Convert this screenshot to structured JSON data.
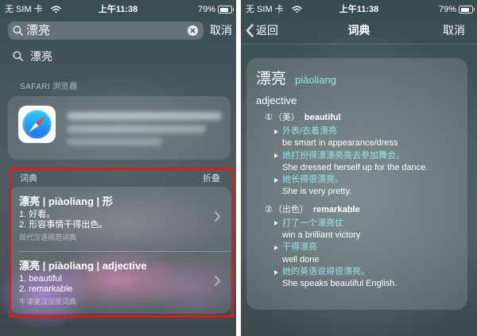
{
  "colors": {
    "accent": "#9be2e8",
    "annotation": "#e0191b"
  },
  "icons": [
    "wifi-icon",
    "battery-icon",
    "search-icon",
    "clear-icon",
    "safari-icon",
    "chevron-right-icon",
    "chevron-left-icon",
    "bullet-icon"
  ],
  "left": {
    "status_bar": {
      "carrier": "无 SIM 卡",
      "time": "上午11:38",
      "battery": "79%"
    },
    "search": {
      "value": "漂亮",
      "cancel_label": "取消"
    },
    "suggestion": {
      "text": "漂亮"
    },
    "safari": {
      "header": "SAFARI 浏览器"
    },
    "dictionary": {
      "header": "词典",
      "collapse_label": "折叠",
      "entries": [
        {
          "title": "漂亮 | piàoliang | 形",
          "senses": [
            "1. 好看。",
            "2. 形容事情干得出色。"
          ],
          "source": "现代汉语规范词典"
        },
        {
          "title": "漂亮 | piàoliang | adjective",
          "senses": [
            "1. beautiful",
            "2. remarkable"
          ],
          "source": "牛津英汉汉英词典"
        }
      ]
    }
  },
  "right": {
    "status_bar": {
      "carrier": "无 SIM 卡",
      "time": "上午11:38",
      "battery": "79%"
    },
    "nav": {
      "back_label": "返回",
      "title": "词典",
      "cancel_label": "取消"
    },
    "entry": {
      "headword": "漂亮",
      "pinyin": "piàoliang",
      "part_of_speech": "adjective",
      "senses": [
        {
          "number": "①",
          "label": "（美）",
          "gloss": "beautiful",
          "examples": [
            {
              "zh": "外表/衣着漂亮",
              "en": "be smart in appearance/dress"
            },
            {
              "zh": "她打扮得漂漂亮亮去参加舞会。",
              "en": "She dressed herself up for the dance."
            },
            {
              "zh": "她长得很漂亮。",
              "en": "She is very pretty."
            }
          ]
        },
        {
          "number": "②",
          "label": "（出色）",
          "gloss": "remarkable",
          "examples": [
            {
              "zh": "打了一个漂亮仗",
              "en": "win a brilliant victory"
            },
            {
              "zh": "干得漂亮",
              "en": "well done"
            },
            {
              "zh": "她的英语说得很漂亮。",
              "en": "She speaks beautiful English."
            }
          ]
        }
      ]
    }
  }
}
